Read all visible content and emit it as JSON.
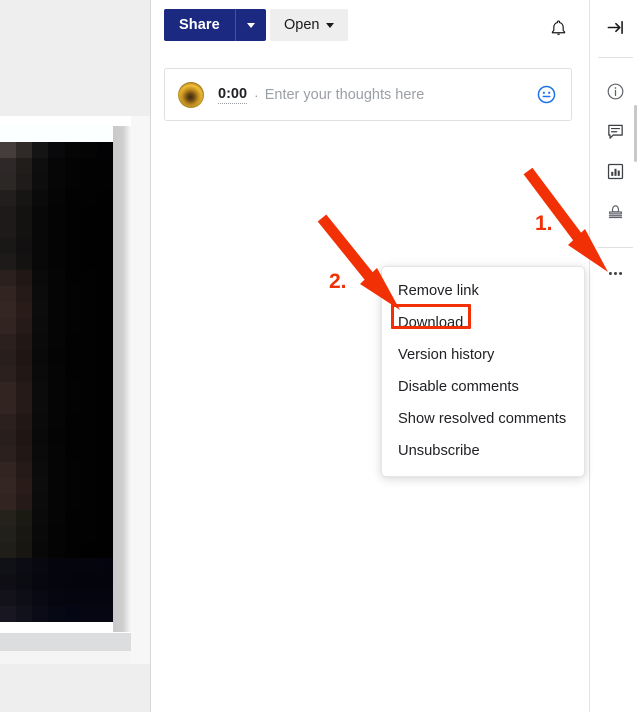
{
  "app": {
    "name": "media-review-app"
  },
  "left_panel": {
    "name": "media-preview-panel",
    "content_type": "blurred-dark-video-thumbnail"
  },
  "toolbar": {
    "share_label": "Share",
    "share_caret_icon": "chevron-down-icon",
    "open_label": "Open",
    "open_caret_icon": "chevron-down-icon",
    "notifications_icon": "bell-icon",
    "share_color": "#1b2a80",
    "open_bg_color": "#eeeeee"
  },
  "composer": {
    "avatar_alt": "user-avatar",
    "timestamp": "0:00",
    "separator": "·",
    "placeholder": "Enter your thoughts here",
    "emoji_icon": "emoji-smiley-icon",
    "emoji_color": "#1a73e8"
  },
  "sidebar": {
    "items": [
      {
        "icon": "collapse-panel-arrow-icon",
        "label": "Collapse panel"
      },
      {
        "icon": "info-circle-icon",
        "label": "Details"
      },
      {
        "icon": "comment-bubble-icon",
        "label": "Comments"
      },
      {
        "icon": "bar-chart-icon",
        "label": "Analytics"
      },
      {
        "icon": "stamp-icon",
        "label": "Approvals"
      },
      {
        "icon": "more-options-icon",
        "label": "More options"
      }
    ]
  },
  "context_menu": {
    "items": [
      {
        "label": "Remove link",
        "highlighted": false
      },
      {
        "label": "Download",
        "highlighted": true
      },
      {
        "label": "Version history",
        "highlighted": false
      },
      {
        "label": "Disable comments",
        "highlighted": false
      },
      {
        "label": "Show resolved comments",
        "highlighted": false
      },
      {
        "label": "Unsubscribe",
        "highlighted": false
      }
    ]
  },
  "annotations": {
    "accent_color": "#f23005",
    "steps": [
      {
        "number": "1.",
        "target": "more-options-icon"
      },
      {
        "number": "2.",
        "target": "menu-item-download"
      }
    ]
  }
}
